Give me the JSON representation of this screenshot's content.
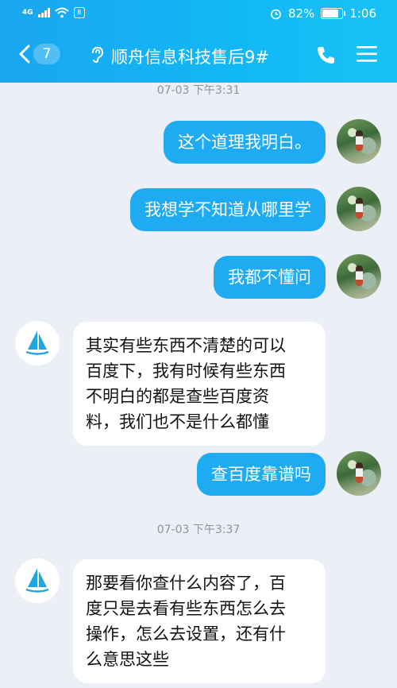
{
  "status_bar": {
    "network": "4G",
    "battery_text": "82%",
    "time": "1:06"
  },
  "header": {
    "back_count": "7",
    "title": "顺舟信息科技售后9#",
    "colors": {
      "bar": "#14b0f3",
      "bubble": "#1fabf2"
    }
  },
  "messages": [
    {
      "type": "timestamp",
      "text": "07-03 下午3:31"
    },
    {
      "type": "sent",
      "text": "这个道理我明白。"
    },
    {
      "type": "sent",
      "text": "我想学不知道从哪里学"
    },
    {
      "type": "sent",
      "text": "我都不懂问"
    },
    {
      "type": "received",
      "lines": [
        "其实有些东西不清楚的可以",
        "百度下，我有时候有些东西",
        "不明白的都是查些百度资",
        "料，我们也不是什么都懂"
      ]
    },
    {
      "type": "sent",
      "text": "查百度靠谱吗"
    },
    {
      "type": "timestamp",
      "text": "07-03 下午3:37"
    },
    {
      "type": "received",
      "lines": [
        "那要看你查什么内容了，百",
        "度只是去看有些东西怎么去",
        "操作，怎么去设置，还有什",
        "么意思这些"
      ]
    }
  ],
  "icons": [
    "back-icon",
    "ear-icon",
    "phone-icon",
    "menu-icon",
    "sailboat-icon",
    "wifi-icon",
    "battery-icon",
    "alarm-icon"
  ]
}
